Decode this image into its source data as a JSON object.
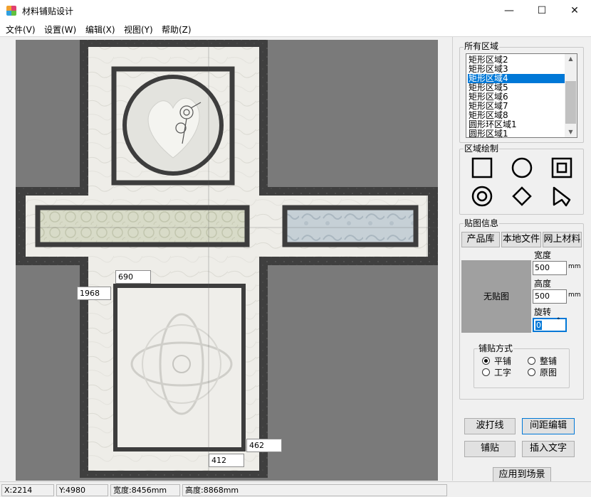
{
  "window": {
    "title": "材料铺贴设计",
    "controls": {
      "minimize": "—",
      "maximize": "☐",
      "close": "✕"
    }
  },
  "menu": [
    "文件(V)",
    "设置(W)",
    "编辑(X)",
    "视图(Y)",
    "帮助(Z)"
  ],
  "canvas": {
    "dims": [
      "690",
      "1968",
      "462",
      "412"
    ]
  },
  "regions": {
    "title": "所有区域",
    "items": [
      "矩形区域2",
      "矩形区域3",
      "矩形区域4",
      "矩形区域5",
      "矩形区域6",
      "矩形区域7",
      "矩形区域8",
      "圆形环区域1",
      "圆形区域1"
    ],
    "selected_index": 2
  },
  "draw": {
    "title": "区域绘制",
    "tools": [
      "square-icon",
      "circle-icon",
      "square-ring-icon",
      "circle-ring-icon",
      "diamond-icon",
      "polygon-icon"
    ]
  },
  "texture": {
    "title": "贴图信息",
    "source_buttons": [
      "产品库",
      "本地文件",
      "网上材料"
    ],
    "preview_text": "无贴图",
    "width_label": "宽度",
    "width_value": "500",
    "height_label": "高度",
    "height_value": "500",
    "rotate_label": "旋转",
    "rotate_value": "0",
    "unit_mm": "mm",
    "unit_deg": "°"
  },
  "paving": {
    "title": "铺贴方式",
    "options": [
      "平铺",
      "整铺",
      "工字",
      "原图"
    ],
    "selected": "平铺"
  },
  "actions": [
    "波打线",
    "间距编辑",
    "铺贴",
    "插入文字",
    "应用到场景"
  ],
  "status": {
    "x": "X:2214",
    "y": "Y:4980",
    "width": "宽度:8456mm",
    "height": "高度:8868mm"
  },
  "colors": {
    "canvas_bg": "#7a7a7a",
    "border_dark": "#3d3d3d",
    "floor_light": "#eeede8",
    "selection": "#0078d7"
  }
}
